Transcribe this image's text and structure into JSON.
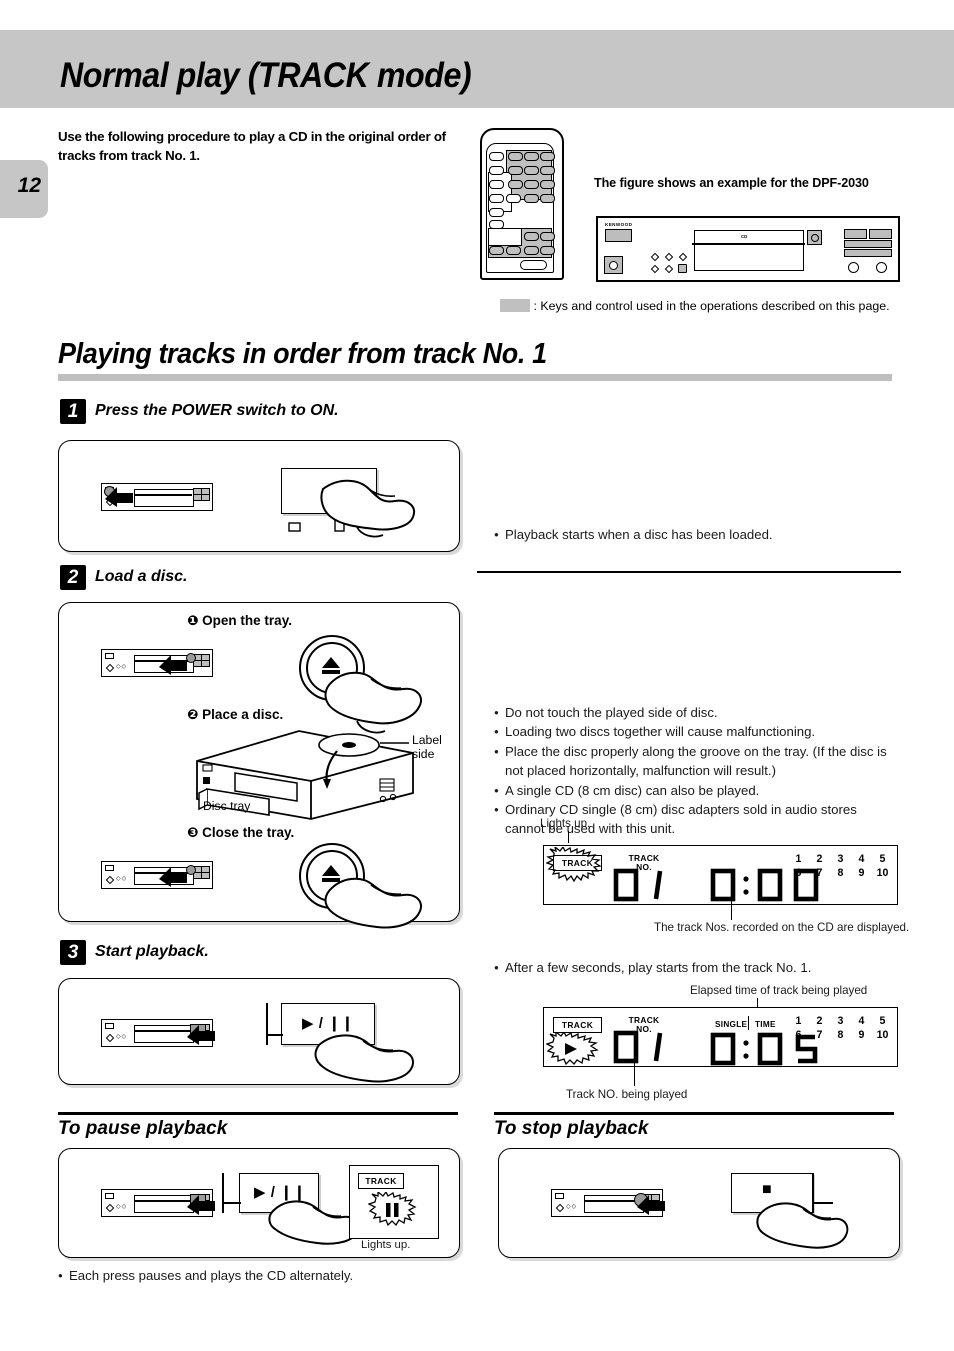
{
  "page": {
    "number": "12",
    "main_title": "Normal play  (TRACK mode)",
    "intro": "Use the following procedure to play a CD in the original order of tracks from track No. 1.",
    "figure_note": "The figure shows an example for the DPF-2030",
    "legend": ": Keys and control used in the operations described on this page.",
    "deck_brand": "KENWOOD",
    "deck_display_text": "CD"
  },
  "section": {
    "title": "Playing tracks in order from track No. 1"
  },
  "steps": [
    {
      "num": "1",
      "title": "Press the POWER switch to ON."
    },
    {
      "num": "2",
      "title": "Load a disc."
    },
    {
      "num": "3",
      "title": "Start playback."
    }
  ],
  "step2_panel": {
    "sub1": "❶ Open the tray.",
    "sub2": "❷ Place a disc.",
    "sub3": "❸ Close the tray.",
    "label_side": "Label side",
    "disc_tray": "Disc tray"
  },
  "notes": {
    "step1_bullets": [
      "Playback starts when a disc has been loaded."
    ],
    "step2_bullets": [
      "Do not touch the played side of disc.",
      "Loading two discs together will cause malfunctioning.",
      "Place the disc properly along the groove on the tray. (If the disc is not placed horizontally, malfunction will result.)",
      "A single CD (8 cm disc) can also be played.",
      "Ordinary CD single (8 cm) disc adapters sold in audio stores cannot be used with this unit."
    ],
    "step3_bullets": [
      "After a few seconds, play starts from the track No. 1."
    ],
    "pause_bullets": [
      "Each press pauses and plays the CD alternately."
    ]
  },
  "display_1": {
    "lights_up": "Lights up.",
    "track_badge": "TRACK",
    "track_no_label_line1": "TRACK",
    "track_no_label_line2": "NO.",
    "track_number": "01",
    "time": "0:00",
    "numbers_row1": [
      "1",
      "2",
      "3",
      "4",
      "5"
    ],
    "numbers_row2": [
      "6",
      "7",
      "8",
      "9",
      "10"
    ],
    "caption": "The track Nos. recorded on the CD are displayed."
  },
  "display_2": {
    "track_badge": "TRACK",
    "track_no_label_line1": "TRACK",
    "track_no_label_line2": "NO.",
    "track_number": "01",
    "time": "0:05",
    "single_label": "SINGLE",
    "time_label": "TIME",
    "numbers_row1": [
      "1",
      "2",
      "3",
      "4",
      "5"
    ],
    "numbers_row2": [
      "6",
      "7",
      "8",
      "9",
      "10"
    ],
    "caption_top": "Elapsed time of track being played",
    "caption_bottom": "Track NO. being played"
  },
  "bottom": {
    "pause_title": "To pause playback",
    "stop_title": "To stop playback",
    "pause_key_label": "▶ / ❙❙",
    "stop_key_label": "■",
    "pause_display_badge": "TRACK",
    "pause_display_lights_up": "Lights up."
  },
  "keys": {
    "play_pause": "▶ / ❙❙",
    "stop": "■"
  }
}
